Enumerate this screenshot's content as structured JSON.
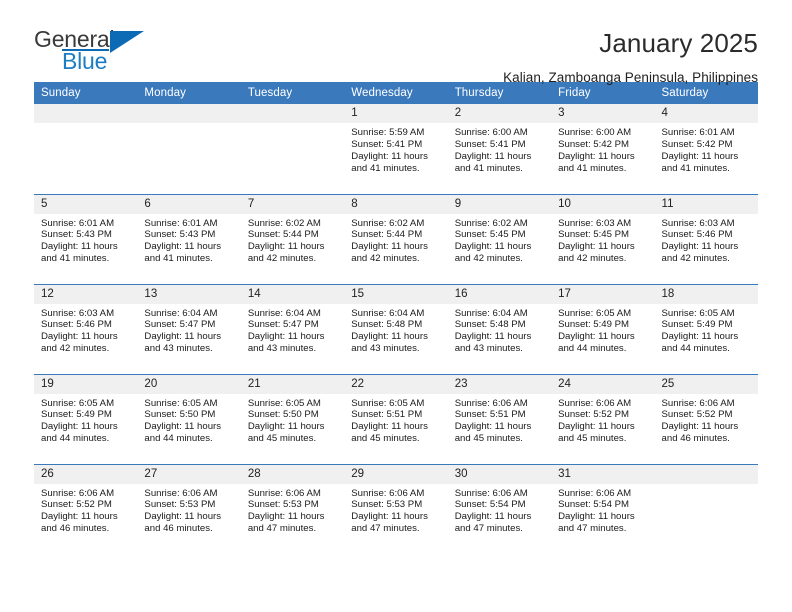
{
  "brand": {
    "name_part1": "General",
    "name_part2": "Blue",
    "accent_color": "#0d6bb5"
  },
  "header": {
    "title": "January 2025",
    "subtitle": "Kalian, Zamboanga Peninsula, Philippines"
  },
  "theme": {
    "header_blue": "#3b79bd",
    "band_gray": "#f0f0f0"
  },
  "calendar": {
    "weekday_headers": [
      "Sunday",
      "Monday",
      "Tuesday",
      "Wednesday",
      "Thursday",
      "Friday",
      "Saturday"
    ],
    "weeks": [
      [
        {
          "day": "",
          "empty": true
        },
        {
          "day": "",
          "empty": true
        },
        {
          "day": "",
          "empty": true
        },
        {
          "day": "1",
          "sunrise": "Sunrise: 5:59 AM",
          "sunset": "Sunset: 5:41 PM",
          "daylight1": "Daylight: 11 hours",
          "daylight2": "and 41 minutes."
        },
        {
          "day": "2",
          "sunrise": "Sunrise: 6:00 AM",
          "sunset": "Sunset: 5:41 PM",
          "daylight1": "Daylight: 11 hours",
          "daylight2": "and 41 minutes."
        },
        {
          "day": "3",
          "sunrise": "Sunrise: 6:00 AM",
          "sunset": "Sunset: 5:42 PM",
          "daylight1": "Daylight: 11 hours",
          "daylight2": "and 41 minutes."
        },
        {
          "day": "4",
          "sunrise": "Sunrise: 6:01 AM",
          "sunset": "Sunset: 5:42 PM",
          "daylight1": "Daylight: 11 hours",
          "daylight2": "and 41 minutes."
        }
      ],
      [
        {
          "day": "5",
          "sunrise": "Sunrise: 6:01 AM",
          "sunset": "Sunset: 5:43 PM",
          "daylight1": "Daylight: 11 hours",
          "daylight2": "and 41 minutes."
        },
        {
          "day": "6",
          "sunrise": "Sunrise: 6:01 AM",
          "sunset": "Sunset: 5:43 PM",
          "daylight1": "Daylight: 11 hours",
          "daylight2": "and 41 minutes."
        },
        {
          "day": "7",
          "sunrise": "Sunrise: 6:02 AM",
          "sunset": "Sunset: 5:44 PM",
          "daylight1": "Daylight: 11 hours",
          "daylight2": "and 42 minutes."
        },
        {
          "day": "8",
          "sunrise": "Sunrise: 6:02 AM",
          "sunset": "Sunset: 5:44 PM",
          "daylight1": "Daylight: 11 hours",
          "daylight2": "and 42 minutes."
        },
        {
          "day": "9",
          "sunrise": "Sunrise: 6:02 AM",
          "sunset": "Sunset: 5:45 PM",
          "daylight1": "Daylight: 11 hours",
          "daylight2": "and 42 minutes."
        },
        {
          "day": "10",
          "sunrise": "Sunrise: 6:03 AM",
          "sunset": "Sunset: 5:45 PM",
          "daylight1": "Daylight: 11 hours",
          "daylight2": "and 42 minutes."
        },
        {
          "day": "11",
          "sunrise": "Sunrise: 6:03 AM",
          "sunset": "Sunset: 5:46 PM",
          "daylight1": "Daylight: 11 hours",
          "daylight2": "and 42 minutes."
        }
      ],
      [
        {
          "day": "12",
          "sunrise": "Sunrise: 6:03 AM",
          "sunset": "Sunset: 5:46 PM",
          "daylight1": "Daylight: 11 hours",
          "daylight2": "and 42 minutes."
        },
        {
          "day": "13",
          "sunrise": "Sunrise: 6:04 AM",
          "sunset": "Sunset: 5:47 PM",
          "daylight1": "Daylight: 11 hours",
          "daylight2": "and 43 minutes."
        },
        {
          "day": "14",
          "sunrise": "Sunrise: 6:04 AM",
          "sunset": "Sunset: 5:47 PM",
          "daylight1": "Daylight: 11 hours",
          "daylight2": "and 43 minutes."
        },
        {
          "day": "15",
          "sunrise": "Sunrise: 6:04 AM",
          "sunset": "Sunset: 5:48 PM",
          "daylight1": "Daylight: 11 hours",
          "daylight2": "and 43 minutes."
        },
        {
          "day": "16",
          "sunrise": "Sunrise: 6:04 AM",
          "sunset": "Sunset: 5:48 PM",
          "daylight1": "Daylight: 11 hours",
          "daylight2": "and 43 minutes."
        },
        {
          "day": "17",
          "sunrise": "Sunrise: 6:05 AM",
          "sunset": "Sunset: 5:49 PM",
          "daylight1": "Daylight: 11 hours",
          "daylight2": "and 44 minutes."
        },
        {
          "day": "18",
          "sunrise": "Sunrise: 6:05 AM",
          "sunset": "Sunset: 5:49 PM",
          "daylight1": "Daylight: 11 hours",
          "daylight2": "and 44 minutes."
        }
      ],
      [
        {
          "day": "19",
          "sunrise": "Sunrise: 6:05 AM",
          "sunset": "Sunset: 5:49 PM",
          "daylight1": "Daylight: 11 hours",
          "daylight2": "and 44 minutes."
        },
        {
          "day": "20",
          "sunrise": "Sunrise: 6:05 AM",
          "sunset": "Sunset: 5:50 PM",
          "daylight1": "Daylight: 11 hours",
          "daylight2": "and 44 minutes."
        },
        {
          "day": "21",
          "sunrise": "Sunrise: 6:05 AM",
          "sunset": "Sunset: 5:50 PM",
          "daylight1": "Daylight: 11 hours",
          "daylight2": "and 45 minutes."
        },
        {
          "day": "22",
          "sunrise": "Sunrise: 6:05 AM",
          "sunset": "Sunset: 5:51 PM",
          "daylight1": "Daylight: 11 hours",
          "daylight2": "and 45 minutes."
        },
        {
          "day": "23",
          "sunrise": "Sunrise: 6:06 AM",
          "sunset": "Sunset: 5:51 PM",
          "daylight1": "Daylight: 11 hours",
          "daylight2": "and 45 minutes."
        },
        {
          "day": "24",
          "sunrise": "Sunrise: 6:06 AM",
          "sunset": "Sunset: 5:52 PM",
          "daylight1": "Daylight: 11 hours",
          "daylight2": "and 45 minutes."
        },
        {
          "day": "25",
          "sunrise": "Sunrise: 6:06 AM",
          "sunset": "Sunset: 5:52 PM",
          "daylight1": "Daylight: 11 hours",
          "daylight2": "and 46 minutes."
        }
      ],
      [
        {
          "day": "26",
          "sunrise": "Sunrise: 6:06 AM",
          "sunset": "Sunset: 5:52 PM",
          "daylight1": "Daylight: 11 hours",
          "daylight2": "and 46 minutes."
        },
        {
          "day": "27",
          "sunrise": "Sunrise: 6:06 AM",
          "sunset": "Sunset: 5:53 PM",
          "daylight1": "Daylight: 11 hours",
          "daylight2": "and 46 minutes."
        },
        {
          "day": "28",
          "sunrise": "Sunrise: 6:06 AM",
          "sunset": "Sunset: 5:53 PM",
          "daylight1": "Daylight: 11 hours",
          "daylight2": "and 47 minutes."
        },
        {
          "day": "29",
          "sunrise": "Sunrise: 6:06 AM",
          "sunset": "Sunset: 5:53 PM",
          "daylight1": "Daylight: 11 hours",
          "daylight2": "and 47 minutes."
        },
        {
          "day": "30",
          "sunrise": "Sunrise: 6:06 AM",
          "sunset": "Sunset: 5:54 PM",
          "daylight1": "Daylight: 11 hours",
          "daylight2": "and 47 minutes."
        },
        {
          "day": "31",
          "sunrise": "Sunrise: 6:06 AM",
          "sunset": "Sunset: 5:54 PM",
          "daylight1": "Daylight: 11 hours",
          "daylight2": "and 47 minutes."
        },
        {
          "day": "",
          "empty": true
        }
      ]
    ]
  }
}
